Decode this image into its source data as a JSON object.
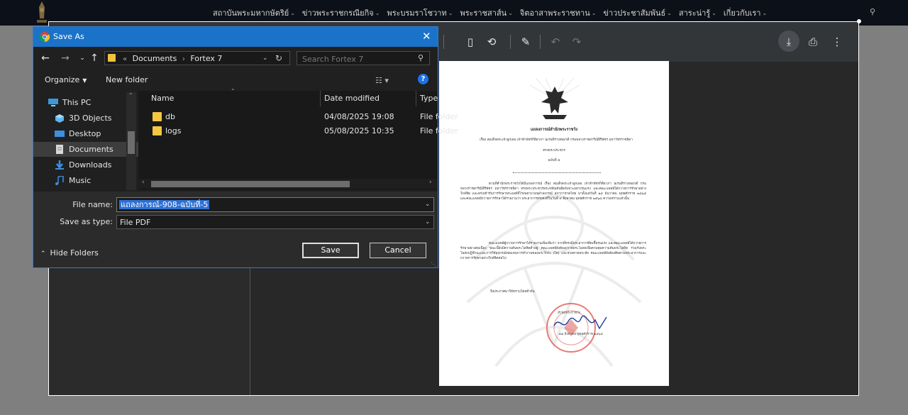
{
  "site": {
    "menu": [
      {
        "label": "สถาบันพระมหากษัตริย์"
      },
      {
        "label": "ข่าวพระราชกรณียกิจ"
      },
      {
        "label": "พระบรมราโชวาท"
      },
      {
        "label": "พระราชสาส์น"
      },
      {
        "label": "จิตอาสาพระราชทาน"
      },
      {
        "label": "ข่าวประชาสัมพันธ์"
      },
      {
        "label": "สาระน่ารู้"
      },
      {
        "label": "เกี่ยวกับเรา"
      }
    ]
  },
  "pdf_page": {
    "heading": "แถลงการณ์สำนักพระราชวัง",
    "subject_line1": "เรื่อง  สมเด็จพระเจ้าลูกเธอ เจ้าฟ้าพัชรกิติยาภา นเรนทิราเทพยวดี กรมหลวงราชสาริณีสิริพัชร มหาวัชรราชธิดา",
    "subject_line2": "ทรงพระประชวร",
    "issue_no": "ฉบับที่ ๕",
    "para1": "ตามที่สำนักพระราชวังได้มีแถลงการณ์ เรื่อง สมเด็จพระเจ้าลูกเธอ เจ้าฟ้าพัชรกิติยาภา นเรนทิราเทพยวดี กรมหลวงราชสาริณีสิริพัชร มหาวัชรราชธิดา ทรงพระประชวรพระหทัยเต้นผิดจังหวะอย่างรุนแรง และคณะแพทย์ได้ถวายการรักษาอย่างใกล้ชิด และทรงเข้ารับการรักษาพระองค์ที่โรงพยาบาลจุฬาลงกรณ์ สภากาชาดไทย มาตั้งแต่วันที่ ๑๕ ธันวาคม พุทธศักราช ๒๕๖๕ และคณะแพทย์ถวายการรักษาได้รายงานว่า พระอาการทรงคงที่ในวันที่ ๙ สิงหาคม พุทธศักราช ๒๕๖๘ ความทราบแล้วนั้น",
    "para2": "คณะแพทย์ผู้ถวายการรักษาได้รายงานเพิ่มเติมว่า จากที่ทรงมีพระอาการติดเชื้อรุนแรง และคณะแพทย์ได้ถวายการรักษาอย่างต่อเนื่อง ขณะนี้ยังมีความดันพระโลหิตต่ำอยู่ คณะแพทย์ยังต้องถวายพระโอสถเพื่อควบคุมความดันพระโลหิต ร่วมกับพระโอสถปฏิชีวนะและการใช้อุปกรณ์ทดแทนการทำงานของพระวักกะ (ไต) และช่วยหายพระทัย คณะแพทย์ยังต้องติดตามพระอาการและถวายการรักษาอย่างใกล้ชิดต่อไป",
    "closing": "จึงประกาศมาให้ทราบโดยทั่วกัน",
    "signer": "สำนักพระราชวัง",
    "date": "๑๗ สิงหาคม พุทธศักราช ๒๕๖๘"
  },
  "dialog": {
    "title": "Save As",
    "path": [
      "Documents",
      "Fortex 7"
    ],
    "search_placeholder": "Search Fortex 7",
    "organize_label": "Organize",
    "new_folder_label": "New folder",
    "tree": [
      {
        "label": "This PC",
        "icon": "this-pc-icon"
      },
      {
        "label": "3D Objects",
        "icon": "3d-objects-icon"
      },
      {
        "label": "Desktop",
        "icon": "desktop-icon"
      },
      {
        "label": "Documents",
        "icon": "documents-icon",
        "selected": true
      },
      {
        "label": "Downloads",
        "icon": "downloads-icon"
      },
      {
        "label": "Music",
        "icon": "music-icon"
      }
    ],
    "columns": {
      "name": "Name",
      "date": "Date modified",
      "type": "Type"
    },
    "files": [
      {
        "name": "db",
        "date": "04/08/2025 19:08",
        "type": "File folder"
      },
      {
        "name": "logs",
        "date": "05/08/2025 10:35",
        "type": "File folder"
      }
    ],
    "file_name_label": "File name:",
    "file_name_value": "แถลงการณ์-908-ฉบับที่-5",
    "save_type_label": "Save as type:",
    "save_type_value": "File PDF",
    "hide_folders_label": "Hide Folders",
    "save_label": "Save",
    "cancel_label": "Cancel"
  },
  "colors": {
    "title_bar": "#1a73c8",
    "folder": "#f3c742",
    "selection": "#2e6fd4"
  }
}
